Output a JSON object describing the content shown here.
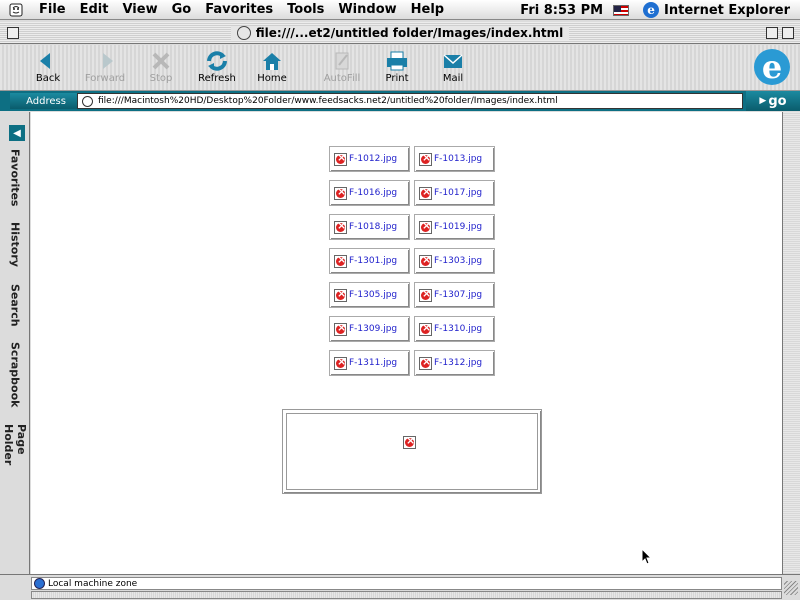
{
  "menubar": {
    "items": [
      "File",
      "Edit",
      "View",
      "Go",
      "Favorites",
      "Tools",
      "Window",
      "Help"
    ],
    "clock": "Fri 8:53 PM",
    "app_name": "Internet Explorer"
  },
  "window": {
    "title": "file:///...et2/untitled folder/Images/index.html"
  },
  "toolbar": {
    "back": "Back",
    "forward": "Forward",
    "stop": "Stop",
    "refresh": "Refresh",
    "home": "Home",
    "autofill": "AutoFill",
    "print": "Print",
    "mail": "Mail"
  },
  "address": {
    "label": "Address",
    "url": "file:///Macintosh%20HD/Desktop%20Folder/www.feedsacks.net2/untitled%20folder/Images/index.html",
    "go": "go"
  },
  "explorer_tabs": [
    "Favorites",
    "History",
    "Search",
    "Scrapbook",
    "Page Holder"
  ],
  "images": [
    "F-1012.jpg",
    "F-1013.jpg",
    "F-1016.jpg",
    "F-1017.jpg",
    "F-1018.jpg",
    "F-1019.jpg",
    "F-1301.jpg",
    "F-1303.jpg",
    "F-1305.jpg",
    "F-1307.jpg",
    "F-1309.jpg",
    "F-1310.jpg",
    "F-1311.jpg",
    "F-1312.jpg"
  ],
  "status": {
    "zone": "Local machine zone"
  },
  "colors": {
    "address_bar": "#0d6f83",
    "link": "#2222cc",
    "broken_icon": "#dd2222"
  }
}
